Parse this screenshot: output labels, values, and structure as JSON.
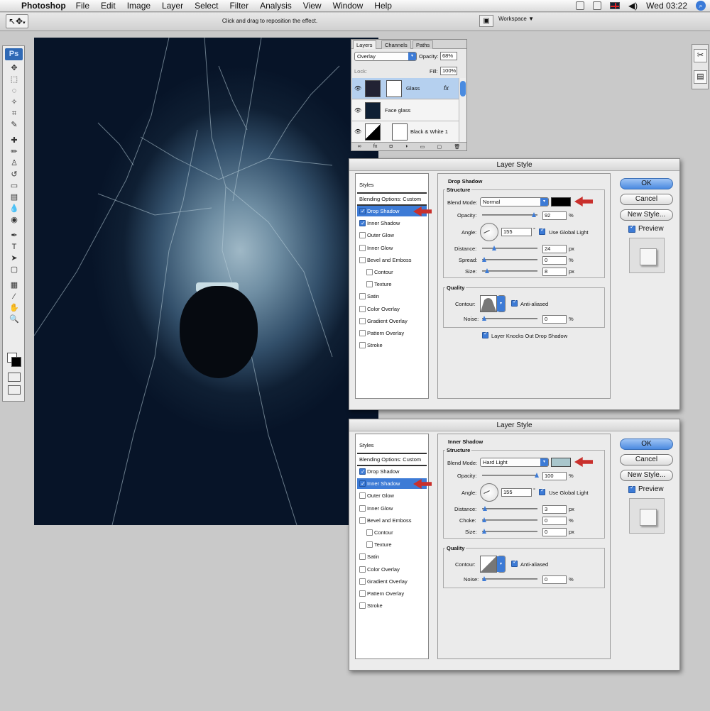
{
  "menubar": {
    "app": "Photoshop",
    "items": [
      "File",
      "Edit",
      "Image",
      "Layer",
      "Select",
      "Filter",
      "Analysis",
      "View",
      "Window",
      "Help"
    ],
    "clock": "Wed 03:22"
  },
  "options": {
    "hint": "Click and drag to reposition the effect.",
    "workspace": "Workspace ▼"
  },
  "tools": {
    "logo": "Ps"
  },
  "layers": {
    "tabs": [
      "Layers",
      "Channels",
      "Paths"
    ],
    "blend_mode": "Overlay",
    "opacity_label": "Opacity:",
    "opacity": "68%",
    "lock_label": "Lock:",
    "fill_label": "Fill:",
    "fill": "100%",
    "rows": [
      {
        "name": "Glass",
        "fx": "fx"
      },
      {
        "name": "Face glass"
      },
      {
        "name": "Black & White 1"
      }
    ]
  },
  "dialog1": {
    "title": "Layer Style",
    "styles_header": "Styles",
    "blending": "Blending Options: Custom",
    "effects": [
      "Drop Shadow",
      "Inner Shadow",
      "Outer Glow",
      "Inner Glow",
      "Bevel and Emboss",
      "Contour",
      "Texture",
      "Satin",
      "Color Overlay",
      "Gradient Overlay",
      "Pattern Overlay",
      "Stroke"
    ],
    "section": "Drop Shadow",
    "structure": "Structure",
    "blend_label": "Blend Mode:",
    "blend_mode": "Normal",
    "swatch_color": "#000000",
    "opacity_label": "Opacity:",
    "opacity": "92",
    "angle_label": "Angle:",
    "angle": "155",
    "global_light": "Use Global Light",
    "distance_label": "Distance:",
    "distance": "24",
    "spread_label": "Spread:",
    "spread": "0",
    "size_label": "Size:",
    "size": "8",
    "quality": "Quality",
    "contour_label": "Contour:",
    "anti_aliased": "Anti-aliased",
    "noise_label": "Noise:",
    "noise": "0",
    "knockout": "Layer Knocks Out Drop Shadow",
    "ok": "OK",
    "cancel": "Cancel",
    "new_style": "New Style...",
    "preview": "Preview",
    "px": "px",
    "pct": "%"
  },
  "dialog2": {
    "title": "Layer Style",
    "styles_header": "Styles",
    "blending": "Blending Options: Custom",
    "effects": [
      "Drop Shadow",
      "Inner Shadow",
      "Outer Glow",
      "Inner Glow",
      "Bevel and Emboss",
      "Contour",
      "Texture",
      "Satin",
      "Color Overlay",
      "Gradient Overlay",
      "Pattern Overlay",
      "Stroke"
    ],
    "section": "Inner Shadow",
    "structure": "Structure",
    "blend_label": "Blend Mode:",
    "blend_mode": "Hard Light",
    "swatch_color": "#a9c6cc",
    "opacity_label": "Opacity:",
    "opacity": "100",
    "angle_label": "Angle:",
    "angle": "155",
    "global_light": "Use Global Light",
    "distance_label": "Distance:",
    "distance": "3",
    "choke_label": "Choke:",
    "choke": "0",
    "size_label": "Size:",
    "size": "0",
    "quality": "Quality",
    "contour_label": "Contour:",
    "anti_aliased": "Anti-aliased",
    "noise_label": "Noise:",
    "noise": "0",
    "ok": "OK",
    "cancel": "Cancel",
    "new_style": "New Style...",
    "preview": "Preview",
    "px": "px",
    "pct": "%"
  },
  "colors": {
    "accent": "#3d7bd6",
    "arrow": "#c9302c"
  }
}
